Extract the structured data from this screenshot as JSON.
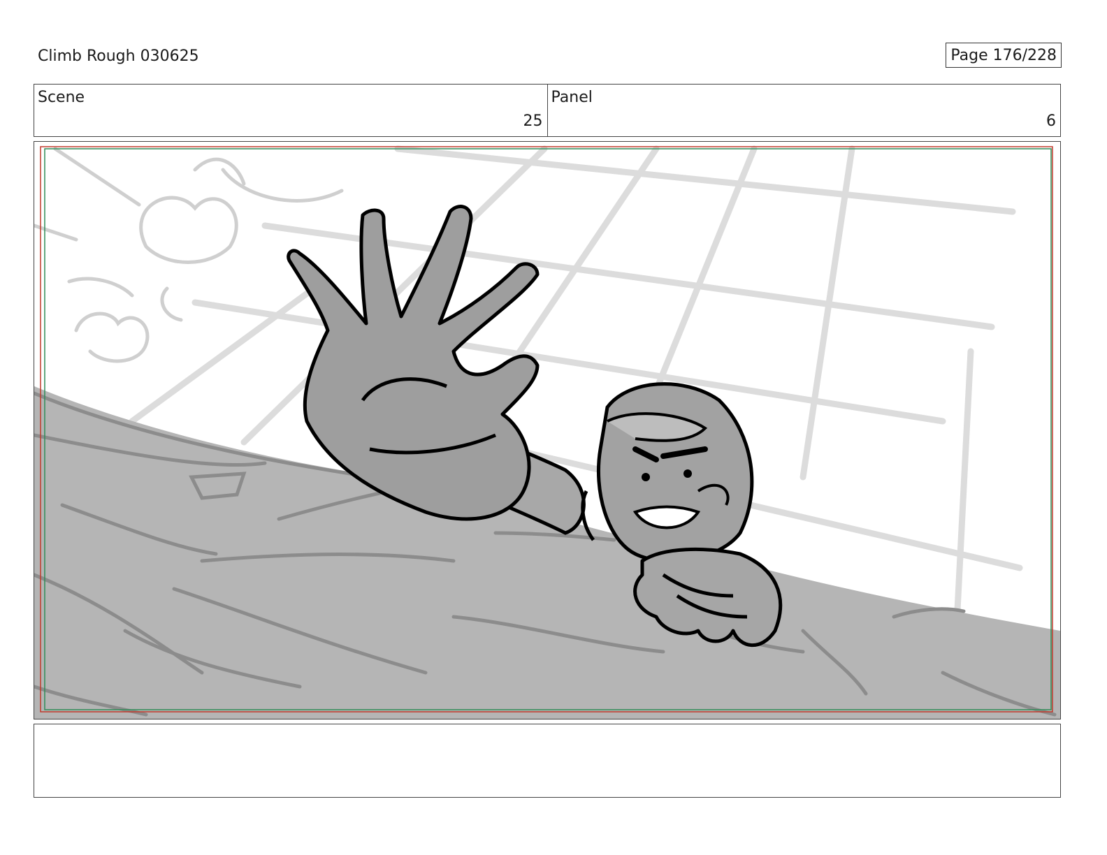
{
  "header": {
    "title": "Climb Rough 030625",
    "page": "Page 176/228"
  },
  "info": {
    "scene_label": "Scene",
    "scene_value": "25",
    "panel_label": "Panel",
    "panel_value": "6"
  },
  "notes": {
    "text": ""
  }
}
